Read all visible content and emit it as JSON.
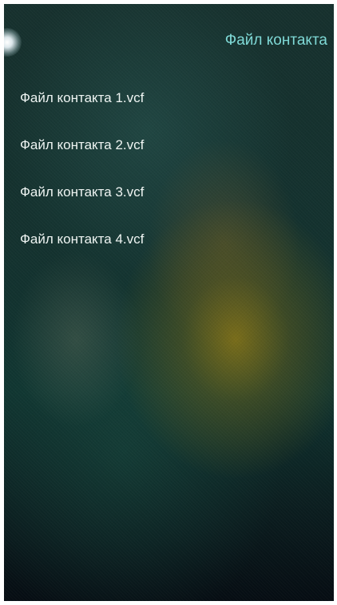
{
  "header": {
    "title": "Файл контакта",
    "title_color": "#7fd9d6"
  },
  "decor": {
    "glow_icon": "light-glow-icon"
  },
  "files": [
    {
      "label": "Файл контакта 1.vcf"
    },
    {
      "label": "Файл контакта 2.vcf"
    },
    {
      "label": "Файл контакта 3.vcf"
    },
    {
      "label": "Файл контакта 4.vcf"
    }
  ]
}
